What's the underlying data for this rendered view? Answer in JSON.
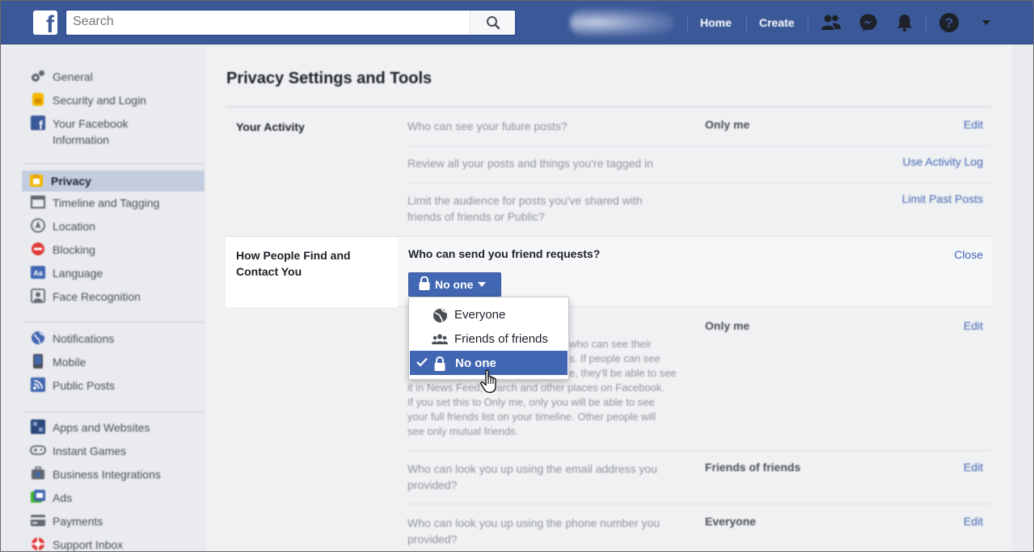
{
  "topbar": {
    "logo": "f",
    "search_placeholder": "Search",
    "nav_home": "Home",
    "nav_create": "Create",
    "icons": [
      "friends-icon",
      "messenger-icon",
      "notifications-icon",
      "help-icon",
      "account-caret-icon"
    ]
  },
  "sidebar": {
    "groups": [
      [
        {
          "label": "General",
          "icon": "gear-icon"
        },
        {
          "label": "Security and Login",
          "icon": "shield-icon"
        },
        {
          "label": "Your Facebook Information",
          "icon": "facebook-icon"
        }
      ],
      [
        {
          "label": "Privacy",
          "icon": "lock-icon",
          "active": true
        },
        {
          "label": "Timeline and Tagging",
          "icon": "timeline-icon"
        },
        {
          "label": "Location",
          "icon": "location-icon"
        },
        {
          "label": "Blocking",
          "icon": "blocking-icon"
        },
        {
          "label": "Language",
          "icon": "language-icon"
        },
        {
          "label": "Face Recognition",
          "icon": "face-icon"
        }
      ],
      [
        {
          "label": "Notifications",
          "icon": "globe-icon"
        },
        {
          "label": "Mobile",
          "icon": "mobile-icon"
        },
        {
          "label": "Public Posts",
          "icon": "rss-icon"
        }
      ],
      [
        {
          "label": "Apps and Websites",
          "icon": "apps-icon"
        },
        {
          "label": "Instant Games",
          "icon": "games-icon"
        },
        {
          "label": "Business Integrations",
          "icon": "business-icon"
        },
        {
          "label": "Ads",
          "icon": "ads-icon"
        },
        {
          "label": "Payments",
          "icon": "payments-icon"
        },
        {
          "label": "Support Inbox",
          "icon": "support-icon"
        }
      ]
    ]
  },
  "main": {
    "title": "Privacy Settings and Tools",
    "your_activity": {
      "label": "Your Activity",
      "rows": [
        {
          "q": "Who can see your future posts?",
          "v": "Only me",
          "a": "Edit"
        },
        {
          "q": "Review all your posts and things you're tagged in",
          "v": "",
          "a": "Use Activity Log"
        },
        {
          "q": "Limit the audience for posts you've shared with friends of friends or Public?",
          "v": "",
          "a": "Limit Past Posts"
        }
      ]
    },
    "find_contact": {
      "label": "How People Find and Contact You",
      "question": "Who can send you friend requests?",
      "close": "Close",
      "selected": "No one",
      "options": [
        {
          "label": "Everyone",
          "icon": "globe-icon"
        },
        {
          "label": "Friends of friends",
          "icon": "friends-icon"
        },
        {
          "label": "No one",
          "icon": "lock-icon",
          "selected": true
        }
      ],
      "friends_list": {
        "text_line1": "who can see their",
        "text_line2": "s. If people can see",
        "text_line3": "e, they'll be able to see",
        "text_line4": "it in News Feed, search and other places on Facebook.",
        "text_line5": "If you set this to Only me, only you will be able to see",
        "text_line6": "your full friends list on your timeline. Other people will",
        "text_line7": "see only mutual friends.",
        "v": "Only me",
        "a": "Edit"
      },
      "rows": [
        {
          "q": "Who can look you up using the email address you provided?",
          "v": "Friends of friends",
          "a": "Edit"
        },
        {
          "q": "Who can look you up using the phone number you provided?",
          "v": "Everyone",
          "a": "Edit"
        }
      ]
    }
  }
}
